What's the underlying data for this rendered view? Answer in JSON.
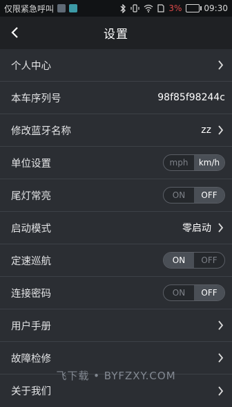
{
  "status_bar": {
    "carrier": "仅限紧急呼叫",
    "battery_percent": "3%",
    "time": "09:30"
  },
  "header": {
    "title": "设置"
  },
  "rows": {
    "personal_center": {
      "label": "个人中心"
    },
    "serial_number": {
      "label": "本车序列号",
      "value": "98f85f98244c"
    },
    "bt_name": {
      "label": "修改蓝牙名称",
      "value": "zz"
    },
    "unit": {
      "label": "单位设置",
      "option_a": "mph",
      "option_b": "km/h",
      "selected": "km/h"
    },
    "tail_light": {
      "label": "尾灯常亮",
      "on": "ON",
      "off": "OFF",
      "selected": "OFF"
    },
    "start_mode": {
      "label": "启动模式",
      "value": "零启动"
    },
    "cruise": {
      "label": "定速巡航",
      "on": "ON",
      "off": "OFF",
      "selected": "ON"
    },
    "password": {
      "label": "连接密码",
      "on": "ON",
      "off": "OFF",
      "selected": "OFF"
    },
    "manual": {
      "label": "用户手册"
    },
    "diagnosis": {
      "label": "故障检修"
    },
    "about": {
      "label": "关于我们"
    }
  },
  "watermark": "飞下载 • BYFZXY.COM"
}
